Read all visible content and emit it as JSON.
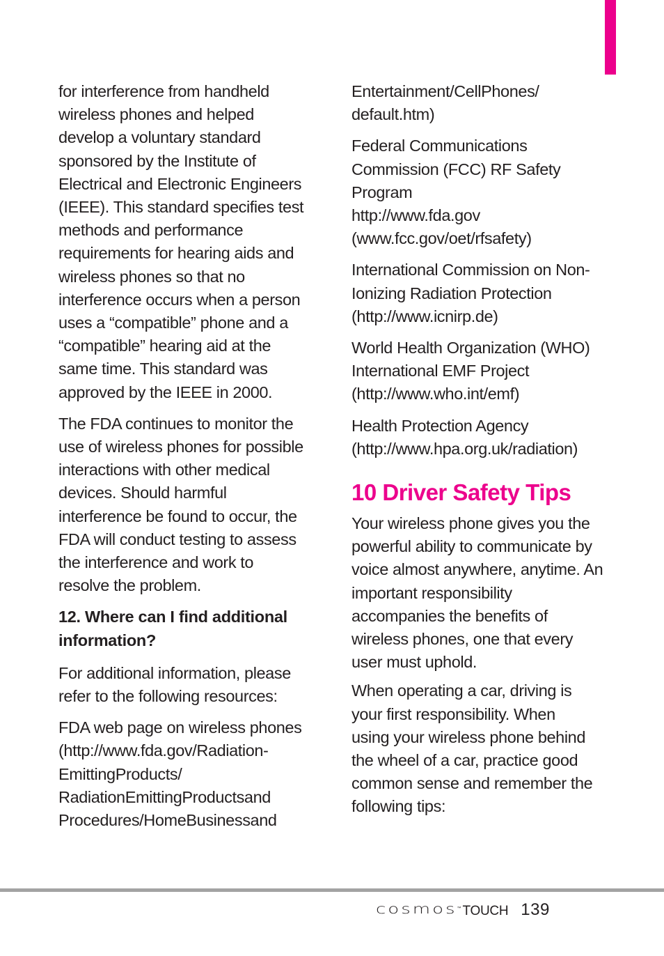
{
  "accent_color": "#ec008c",
  "left_column": {
    "para1": [
      "for interference from handheld",
      "wireless phones and helped",
      "develop a voluntary standard",
      "sponsored by the Institute of",
      "Electrical and Electronic Engineers",
      "(IEEE). This standard specifies test",
      "methods and performance",
      "requirements for hearing aids and",
      "wireless phones so that no",
      "interference occurs when a person",
      "uses a “compatible” phone and a",
      "“compatible” hearing aid at the",
      "same time. This standard was",
      "approved by the IEEE in 2000."
    ],
    "para2": [
      "The FDA continues to monitor the",
      "use of wireless phones for possible",
      "interactions with other medical",
      "devices. Should harmful",
      "interference be found to occur, the",
      "FDA will conduct testing to assess",
      "the interference and work to",
      "resolve the problem."
    ],
    "question_heading": [
      "12. Where can I find additional",
      "information?"
    ],
    "para3": [
      "For additional information, please",
      "refer to the following resources:"
    ],
    "resource_fda": [
      "FDA web page on wireless phones",
      "(http://www.fda.gov/Radiation-",
      "EmittingProducts/",
      "RadiationEmittingProductsand",
      "Procedures/HomeBusinessand"
    ]
  },
  "right_column": {
    "resource_fda_cont": [
      "Entertainment/CellPhones/",
      "default.htm)"
    ],
    "resource_fcc": [
      "Federal Communications",
      "Commission (FCC) RF Safety",
      "Program",
      "http://www.fda.gov",
      "(www.fcc.gov/oet/rfsafety)"
    ],
    "resource_icnirp": [
      "International Commission on Non-",
      "Ionizing Radiation Protection",
      "(http://www.icnirp.de)"
    ],
    "resource_who": [
      "World Health Organization (WHO)",
      "International EMF Project",
      "(http://www.who.int/emf)"
    ],
    "resource_hpa": [
      "Health Protection Agency",
      "(http://www.hpa.org.uk/radiation)"
    ],
    "section_title": "10 Driver Safety Tips",
    "intro_para": [
      "Your wireless phone gives you the",
      "powerful ability to communicate by",
      "voice almost anywhere, anytime. An",
      "important responsibility",
      "accompanies the benefits of",
      "wireless phones, one that every",
      "user must uphold."
    ],
    "driving_para": [
      "When operating a car, driving is",
      "your first responsibility. When",
      "using your wireless phone behind",
      "the wheel of a car, practice good",
      "common sense and remember the",
      "following tips:"
    ]
  },
  "footer": {
    "brand": "cosmos",
    "trademark": "™",
    "brand_sub": "TOUCH",
    "page_number": "139"
  }
}
